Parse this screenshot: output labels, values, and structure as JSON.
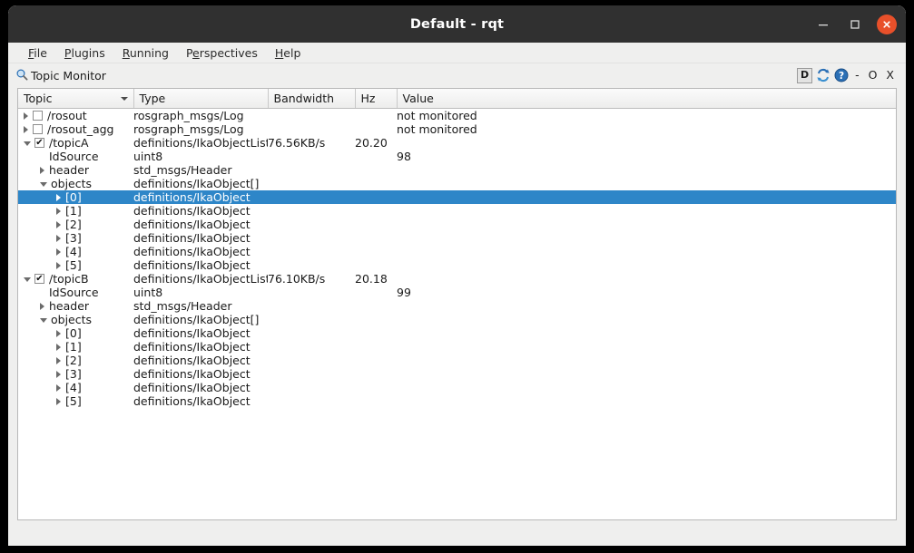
{
  "window": {
    "title": "Default - rqt",
    "buttons": {
      "minimize": "minimize-icon",
      "maximize": "maximize-icon",
      "close": "close-icon"
    }
  },
  "menubar": {
    "items": [
      {
        "label": "File",
        "mnemonic": "F"
      },
      {
        "label": "Plugins",
        "mnemonic": "P"
      },
      {
        "label": "Running",
        "mnemonic": "R"
      },
      {
        "label": "Perspectives",
        "mnemonic": "e"
      },
      {
        "label": "Help",
        "mnemonic": "H"
      }
    ]
  },
  "plugin": {
    "icon": "magnifier-icon",
    "title": "Topic Monitor",
    "actions": {
      "dock_label": "D",
      "refresh_icon": "refresh-icon",
      "help_icon": "help-icon",
      "minimize_label": "-",
      "float_label": "O",
      "close_label": "X"
    }
  },
  "table": {
    "columns": [
      {
        "key": "topic",
        "label": "Topic",
        "sorted": true
      },
      {
        "key": "type",
        "label": "Type"
      },
      {
        "key": "bandwidth",
        "label": "Bandwidth"
      },
      {
        "key": "hz",
        "label": "Hz"
      },
      {
        "key": "value",
        "label": "Value"
      }
    ],
    "rows": [
      {
        "depth": 0,
        "expander": "collapsed",
        "checkbox": "unchecked",
        "topic": "/rosout",
        "type": "rosgraph_msgs/Log",
        "bandwidth": "",
        "hz": "",
        "value": "not monitored",
        "selected": false
      },
      {
        "depth": 0,
        "expander": "collapsed",
        "checkbox": "unchecked",
        "topic": "/rosout_agg",
        "type": "rosgraph_msgs/Log",
        "bandwidth": "",
        "hz": "",
        "value": "not monitored",
        "selected": false
      },
      {
        "depth": 0,
        "expander": "expanded",
        "checkbox": "checked",
        "topic": "/topicA",
        "type": "definitions/IkaObjectList",
        "bandwidth": "76.56KB/s",
        "hz": "20.20",
        "value": "",
        "selected": false
      },
      {
        "depth": 1,
        "expander": "none",
        "checkbox": "none",
        "topic": "IdSource",
        "type": "uint8",
        "bandwidth": "",
        "hz": "",
        "value": "98",
        "selected": false
      },
      {
        "depth": 1,
        "expander": "collapsed",
        "checkbox": "none",
        "topic": "header",
        "type": "std_msgs/Header",
        "bandwidth": "",
        "hz": "",
        "value": "",
        "selected": false
      },
      {
        "depth": 1,
        "expander": "expanded",
        "checkbox": "none",
        "topic": "objects",
        "type": "definitions/IkaObject[]",
        "bandwidth": "",
        "hz": "",
        "value": "",
        "selected": false
      },
      {
        "depth": 2,
        "expander": "collapsed",
        "checkbox": "none",
        "topic": "[0]",
        "type": "definitions/IkaObject",
        "bandwidth": "",
        "hz": "",
        "value": "",
        "selected": true
      },
      {
        "depth": 2,
        "expander": "collapsed",
        "checkbox": "none",
        "topic": "[1]",
        "type": "definitions/IkaObject",
        "bandwidth": "",
        "hz": "",
        "value": "",
        "selected": false
      },
      {
        "depth": 2,
        "expander": "collapsed",
        "checkbox": "none",
        "topic": "[2]",
        "type": "definitions/IkaObject",
        "bandwidth": "",
        "hz": "",
        "value": "",
        "selected": false
      },
      {
        "depth": 2,
        "expander": "collapsed",
        "checkbox": "none",
        "topic": "[3]",
        "type": "definitions/IkaObject",
        "bandwidth": "",
        "hz": "",
        "value": "",
        "selected": false
      },
      {
        "depth": 2,
        "expander": "collapsed",
        "checkbox": "none",
        "topic": "[4]",
        "type": "definitions/IkaObject",
        "bandwidth": "",
        "hz": "",
        "value": "",
        "selected": false
      },
      {
        "depth": 2,
        "expander": "collapsed",
        "checkbox": "none",
        "topic": "[5]",
        "type": "definitions/IkaObject",
        "bandwidth": "",
        "hz": "",
        "value": "",
        "selected": false
      },
      {
        "depth": 0,
        "expander": "expanded",
        "checkbox": "checked",
        "topic": "/topicB",
        "type": "definitions/IkaObjectList",
        "bandwidth": "76.10KB/s",
        "hz": "20.18",
        "value": "",
        "selected": false
      },
      {
        "depth": 1,
        "expander": "none",
        "checkbox": "none",
        "topic": "IdSource",
        "type": "uint8",
        "bandwidth": "",
        "hz": "",
        "value": "99",
        "selected": false
      },
      {
        "depth": 1,
        "expander": "collapsed",
        "checkbox": "none",
        "topic": "header",
        "type": "std_msgs/Header",
        "bandwidth": "",
        "hz": "",
        "value": "",
        "selected": false
      },
      {
        "depth": 1,
        "expander": "expanded",
        "checkbox": "none",
        "topic": "objects",
        "type": "definitions/IkaObject[]",
        "bandwidth": "",
        "hz": "",
        "value": "",
        "selected": false
      },
      {
        "depth": 2,
        "expander": "collapsed",
        "checkbox": "none",
        "topic": "[0]",
        "type": "definitions/IkaObject",
        "bandwidth": "",
        "hz": "",
        "value": "",
        "selected": false
      },
      {
        "depth": 2,
        "expander": "collapsed",
        "checkbox": "none",
        "topic": "[1]",
        "type": "definitions/IkaObject",
        "bandwidth": "",
        "hz": "",
        "value": "",
        "selected": false
      },
      {
        "depth": 2,
        "expander": "collapsed",
        "checkbox": "none",
        "topic": "[2]",
        "type": "definitions/IkaObject",
        "bandwidth": "",
        "hz": "",
        "value": "",
        "selected": false
      },
      {
        "depth": 2,
        "expander": "collapsed",
        "checkbox": "none",
        "topic": "[3]",
        "type": "definitions/IkaObject",
        "bandwidth": "",
        "hz": "",
        "value": "",
        "selected": false
      },
      {
        "depth": 2,
        "expander": "collapsed",
        "checkbox": "none",
        "topic": "[4]",
        "type": "definitions/IkaObject",
        "bandwidth": "",
        "hz": "",
        "value": "",
        "selected": false
      },
      {
        "depth": 2,
        "expander": "collapsed",
        "checkbox": "none",
        "topic": "[5]",
        "type": "definitions/IkaObject",
        "bandwidth": "",
        "hz": "",
        "value": "",
        "selected": false
      }
    ]
  },
  "colors": {
    "titlebar": "#303030",
    "window_bg": "#efefee",
    "selection": "#2e86c8",
    "close_button": "#e8502a",
    "accent_icon": "#2a6fb5"
  }
}
